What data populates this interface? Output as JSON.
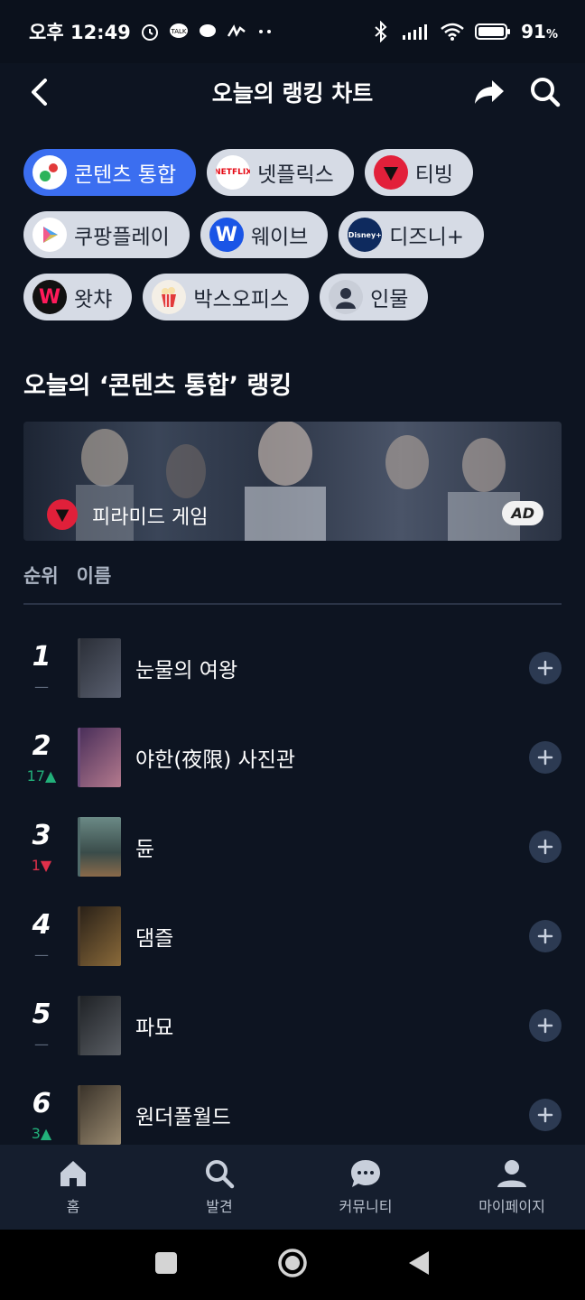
{
  "status": {
    "time": "오후 12:49",
    "battery": "91"
  },
  "header": {
    "title": "오늘의 랭킹 차트"
  },
  "chips": [
    {
      "label": "콘텐츠 통합",
      "active": true
    },
    {
      "label": "넷플릭스",
      "logo_text": "NETFLIX"
    },
    {
      "label": "티빙"
    },
    {
      "label": "쿠팡플레이"
    },
    {
      "label": "웨이브"
    },
    {
      "label": "디즈니+",
      "logo_text": "Disney+"
    },
    {
      "label": "왓챠"
    },
    {
      "label": "박스오피스"
    },
    {
      "label": "인물"
    }
  ],
  "section": {
    "title": "오늘의 ‘콘텐츠 통합’ 랭킹"
  },
  "banner": {
    "title": "피라미드 게임",
    "ad_label": "AD"
  },
  "list_header": {
    "rank": "순위",
    "name": "이름"
  },
  "rankings": [
    {
      "rank": "1",
      "change": "—",
      "trend": "same",
      "title": "눈물의 여왕",
      "poster_color": "#3b3f48"
    },
    {
      "rank": "2",
      "change": "17▲",
      "trend": "up",
      "title": "야한(夜限) 사진관",
      "poster_color": "#6b4a7a"
    },
    {
      "rank": "3",
      "change": "1▼",
      "trend": "down",
      "title": "듄",
      "poster_color": "#4f6a6a"
    },
    {
      "rank": "4",
      "change": "—",
      "trend": "same",
      "title": "댐즐",
      "poster_color": "#4a3a2a"
    },
    {
      "rank": "5",
      "change": "—",
      "trend": "same",
      "title": "파묘",
      "poster_color": "#2e3236"
    },
    {
      "rank": "6",
      "change": "3▲",
      "trend": "up",
      "title": "원더풀월드",
      "poster_color": "#4d4438"
    }
  ],
  "bottom_nav": [
    {
      "label": "홈",
      "icon": "home-icon"
    },
    {
      "label": "발견",
      "icon": "search-icon"
    },
    {
      "label": "커뮤니티",
      "icon": "chat-icon"
    },
    {
      "label": "마이페이지",
      "icon": "profile-icon"
    }
  ]
}
